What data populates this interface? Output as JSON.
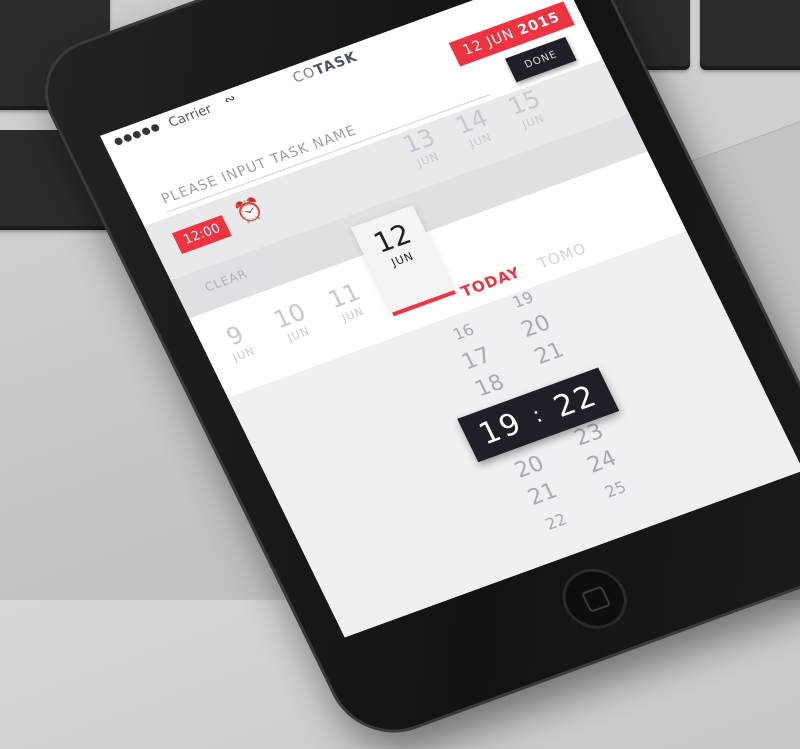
{
  "status_bar": {
    "signal": "●●●●●",
    "carrier": "Carrier",
    "wifi_icon": "wifi-icon",
    "app_title_prefix": "CO",
    "app_title_bold": "TASK"
  },
  "task": {
    "placeholder": "PLEASE INPUT TASK NAME",
    "date_day_month": "12 JUN",
    "date_year": "2015",
    "done_label": "DONE"
  },
  "time": {
    "badge": "12:00",
    "alarm_icon": "alarm-clock-icon"
  },
  "clear_label": "CLEAR",
  "dates_upper": [
    {
      "d": "13",
      "m": "JUN"
    },
    {
      "d": "14",
      "m": "JUN"
    },
    {
      "d": "15",
      "m": "JUN"
    }
  ],
  "dates_row": [
    {
      "d": "9",
      "m": "JUN"
    },
    {
      "d": "10",
      "m": "JUN"
    },
    {
      "d": "11",
      "m": "JUN"
    },
    {
      "d": "12",
      "m": "JUN"
    }
  ],
  "selected_date": {
    "d": "12",
    "m": "JUN"
  },
  "today_label": "TODAY",
  "tomorrow_label": "TOMO",
  "picker": {
    "hours_above": [
      "16",
      "17",
      "18"
    ],
    "minutes_above": [
      "19",
      "20",
      "21"
    ],
    "selected_hour": "19",
    "separator": ":",
    "selected_minute": "22",
    "hours_below": [
      "20",
      "21",
      "22"
    ],
    "minutes_below": [
      "23",
      "24",
      "25"
    ]
  },
  "colors": {
    "accent": "#ef3340",
    "dark": "#1f2027"
  }
}
